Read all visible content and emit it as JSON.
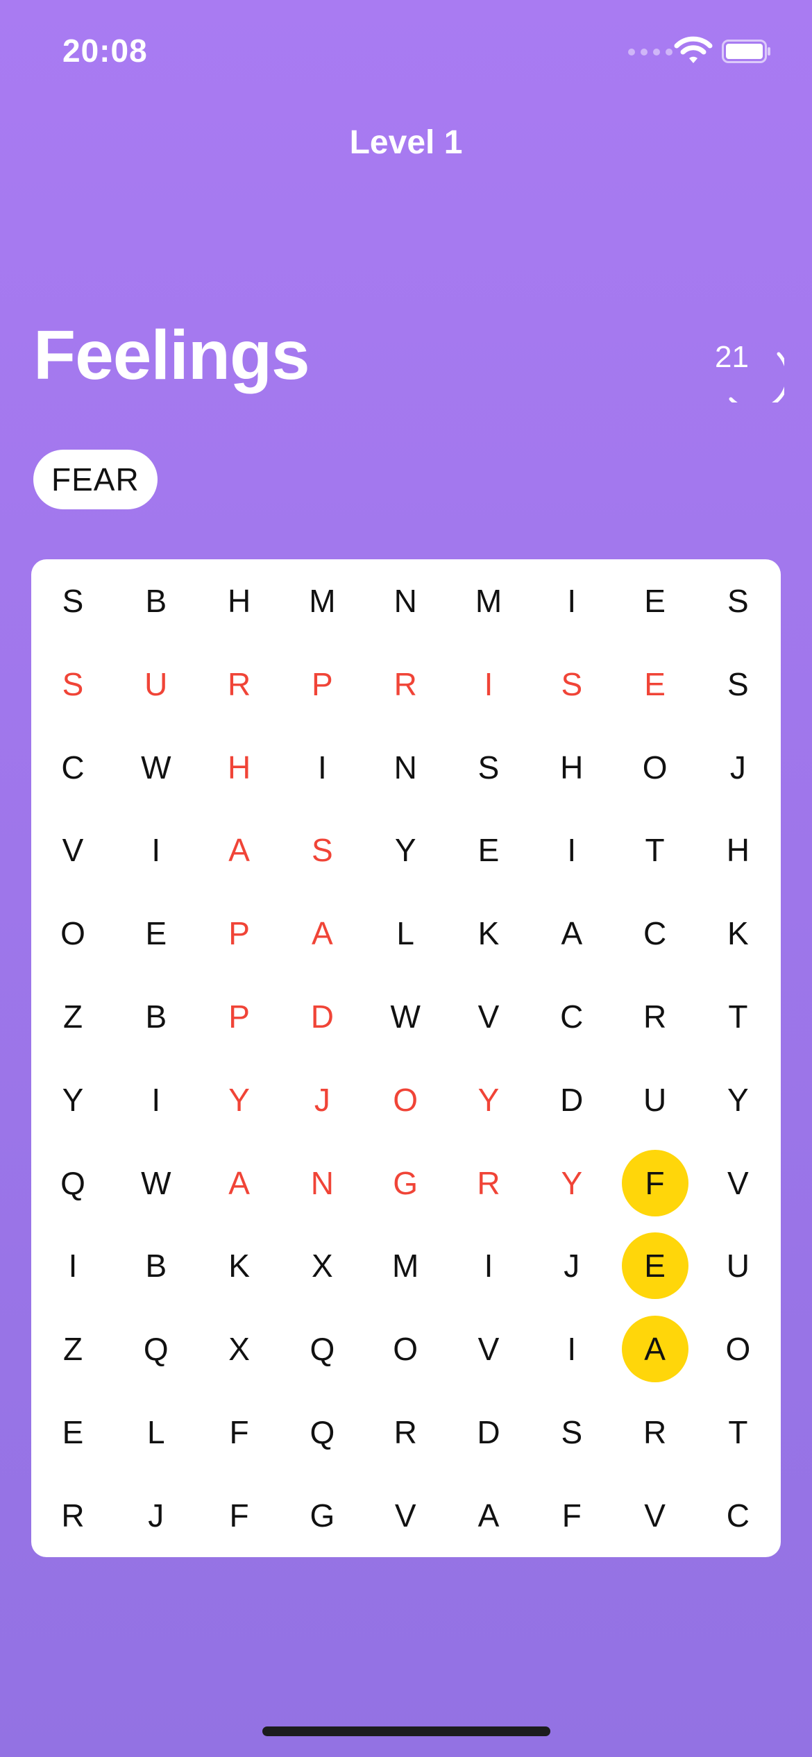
{
  "status_bar": {
    "time": "20:08"
  },
  "header": {
    "level": "Level 1"
  },
  "category": {
    "title": "Feelings"
  },
  "counter": {
    "value": "21"
  },
  "current_word": "FEAR",
  "board": {
    "rows": [
      [
        "S",
        "B",
        "H",
        "M",
        "N",
        "M",
        "I",
        "E",
        "S"
      ],
      [
        "S",
        "U",
        "R",
        "P",
        "R",
        "I",
        "S",
        "E",
        "S"
      ],
      [
        "C",
        "W",
        "H",
        "I",
        "N",
        "S",
        "H",
        "O",
        "J"
      ],
      [
        "V",
        "I",
        "A",
        "S",
        "Y",
        "E",
        "I",
        "T",
        "H"
      ],
      [
        "O",
        "E",
        "P",
        "A",
        "L",
        "K",
        "A",
        "C",
        "K"
      ],
      [
        "Z",
        "B",
        "P",
        "D",
        "W",
        "V",
        "C",
        "R",
        "T"
      ],
      [
        "Y",
        "I",
        "Y",
        "J",
        "O",
        "Y",
        "D",
        "U",
        "Y"
      ],
      [
        "Q",
        "W",
        "A",
        "N",
        "G",
        "R",
        "Y",
        "F",
        "V"
      ],
      [
        "I",
        "B",
        "K",
        "X",
        "M",
        "I",
        "J",
        "E",
        "U"
      ],
      [
        "Z",
        "Q",
        "X",
        "Q",
        "O",
        "V",
        "I",
        "A",
        "O"
      ],
      [
        "E",
        "L",
        "F",
        "Q",
        "R",
        "D",
        "S",
        "R",
        "T"
      ],
      [
        "R",
        "J",
        "F",
        "G",
        "V",
        "A",
        "F",
        "V",
        "C"
      ]
    ],
    "found_cells": [
      [
        1,
        0
      ],
      [
        1,
        1
      ],
      [
        1,
        2
      ],
      [
        1,
        3
      ],
      [
        1,
        4
      ],
      [
        1,
        5
      ],
      [
        1,
        6
      ],
      [
        1,
        7
      ],
      [
        2,
        2
      ],
      [
        3,
        2
      ],
      [
        4,
        2
      ],
      [
        5,
        2
      ],
      [
        6,
        2
      ],
      [
        3,
        3
      ],
      [
        4,
        3
      ],
      [
        5,
        3
      ],
      [
        6,
        3
      ],
      [
        6,
        4
      ],
      [
        6,
        5
      ],
      [
        7,
        2
      ],
      [
        7,
        3
      ],
      [
        7,
        4
      ],
      [
        7,
        5
      ],
      [
        7,
        6
      ]
    ],
    "selected_cells": [
      [
        7,
        7
      ],
      [
        8,
        7
      ],
      [
        9,
        7
      ]
    ]
  },
  "colors": {
    "background_top": "#a97bf2",
    "background_bottom": "#9372e3",
    "found_letter": "#f04437",
    "selected_highlight": "#ffd60a"
  }
}
